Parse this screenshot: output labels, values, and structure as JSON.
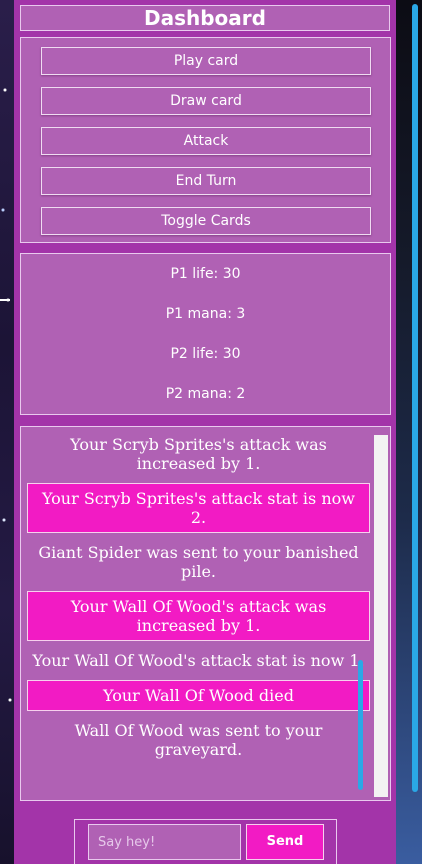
{
  "dashboard": {
    "title": "Dashboard"
  },
  "controls": {
    "buttons": [
      {
        "label": "Play card"
      },
      {
        "label": "Draw card"
      },
      {
        "label": "Attack"
      },
      {
        "label": "End Turn"
      },
      {
        "label": "Toggle Cards"
      }
    ]
  },
  "stats": {
    "p1_life": "P1 life: 30",
    "p1_mana": "P1 mana: 3",
    "p2_life": "P2 life: 30",
    "p2_mana": "P2 mana: 2"
  },
  "log": {
    "messages": [
      {
        "text": "Your Scryb Sprites's attack was increased by 1.",
        "highlight": false
      },
      {
        "text": "Your Scryb Sprites's attack stat is now 2.",
        "highlight": true
      },
      {
        "text": "Giant Spider was sent to your banished pile.",
        "highlight": false
      },
      {
        "text": "Your Wall Of Wood's attack was increased by 1.",
        "highlight": true
      },
      {
        "text": "Your Wall Of Wood's attack stat is now 1.",
        "highlight": false
      },
      {
        "text": "Your Wall Of Wood died",
        "highlight": true
      },
      {
        "text": "Wall Of Wood was sent to your graveyard.",
        "highlight": false
      }
    ]
  },
  "chat": {
    "input_value": "",
    "input_placeholder": "Say hey!",
    "send_label": "Send"
  },
  "colors": {
    "panel": "#a334a9",
    "box": "#b061b4",
    "highlight": "#f21bc4",
    "scrollbar": "#2aa8e6"
  }
}
